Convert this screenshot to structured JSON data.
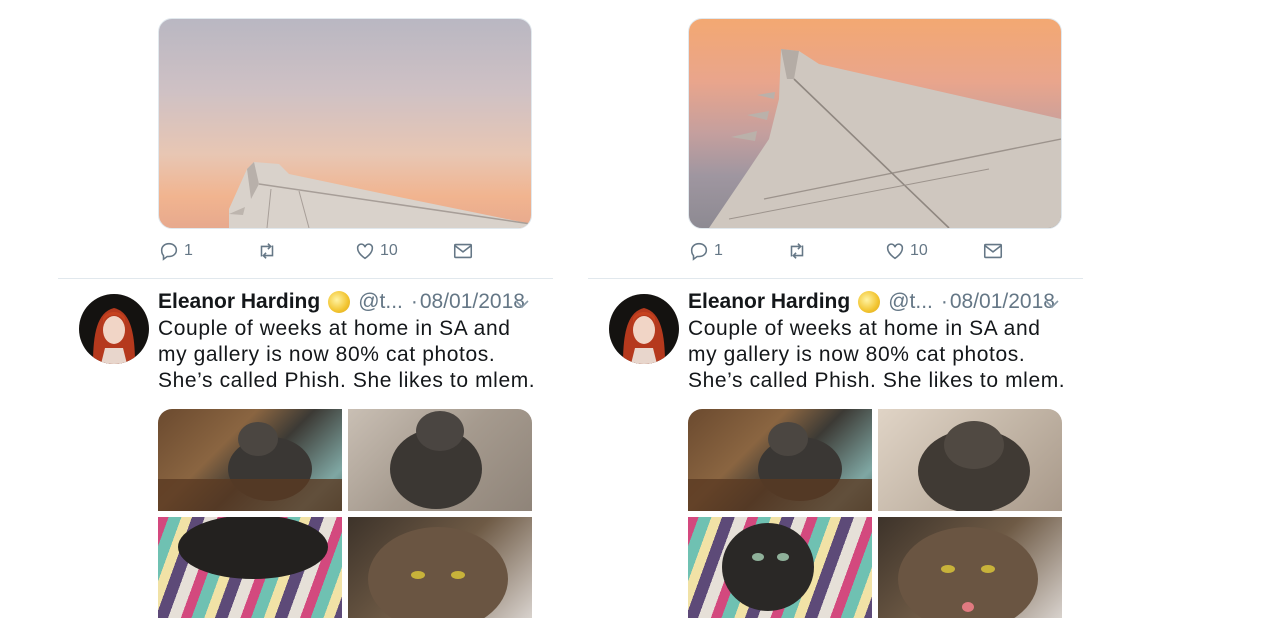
{
  "tweets": [
    {
      "stats": {
        "replies": "1",
        "likes": "10"
      },
      "author": {
        "name": "Eleanor Harding",
        "handle": "@t...",
        "separator": "·",
        "date": "08/01/2018"
      },
      "text": "Couple of weeks at home in SA and my gallery is now 80% cat photos. She’s called Phish. She likes to mlem."
    },
    {
      "stats": {
        "replies": "1",
        "likes": "10"
      },
      "author": {
        "name": "Eleanor Harding",
        "handle": "@t...",
        "separator": "·",
        "date": "08/01/2018"
      },
      "text": "Couple of weeks at home in SA and my gallery is now 80% cat photos. She’s called Phish. She likes to mlem."
    }
  ],
  "icons": [
    "reply-icon",
    "retweet-icon",
    "like-icon",
    "dm-icon",
    "chevron-down-icon"
  ],
  "colors": {
    "secondary_text": "#657786",
    "divider": "#e1e8ed",
    "text": "#14171a"
  }
}
